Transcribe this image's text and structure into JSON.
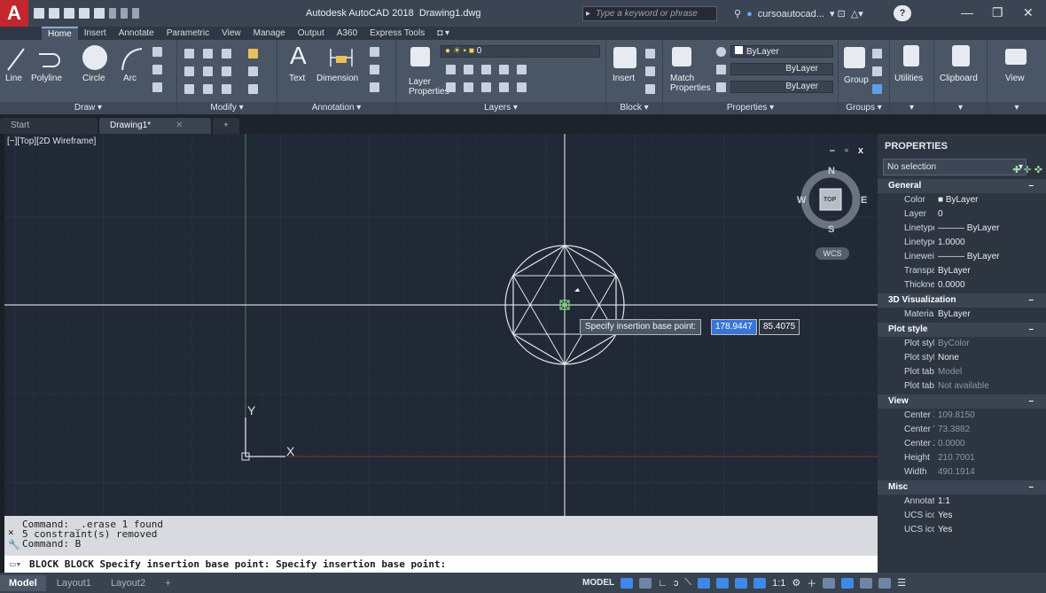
{
  "title": {
    "app": "Autodesk AutoCAD 2018",
    "document": "Drawing1.dwg"
  },
  "search": {
    "placeholder": "Type a keyword or phrase"
  },
  "user": {
    "name": "cursoautocad..."
  },
  "ribbon_tabs": [
    "Home",
    "Insert",
    "Annotate",
    "Parametric",
    "View",
    "Manage",
    "Output",
    "A360",
    "Express Tools"
  ],
  "panels": {
    "draw": {
      "title": "Draw ▾",
      "line": "Line",
      "polyline": "Polyline",
      "circle": "Circle",
      "arc": "Arc"
    },
    "modify": {
      "title": "Modify ▾"
    },
    "annotation": {
      "title": "Annotation ▾",
      "text": "Text",
      "dimension": "Dimension"
    },
    "layers": {
      "title": "Layers ▾",
      "properties_l1": "Layer",
      "properties_l2": "Properties",
      "layer_combo": "0"
    },
    "block": {
      "title": "Block ▾",
      "insert": "Insert"
    },
    "properties": {
      "title": "Properties ▾",
      "match_l1": "Match",
      "match_l2": "Properties",
      "color": "ByLayer",
      "linetype": "ByLayer",
      "lineweight": "ByLayer"
    },
    "groups": {
      "title": "Groups ▾",
      "group": "Group"
    },
    "utilities": {
      "label": "Utilities"
    },
    "clipboard": {
      "label": "Clipboard"
    },
    "view": {
      "label": "View"
    }
  },
  "doc_tabs": {
    "start": "Start",
    "drawing": "Drawing1*"
  },
  "viewport": {
    "label": "[−][Top][2D Wireframe]",
    "controls": "– ▫ x",
    "compass": {
      "n": "N",
      "s": "S",
      "e": "E",
      "w": "W",
      "cube": "TOP"
    },
    "wcs": "WCS",
    "ucs_x": "X",
    "ucs_y": "Y"
  },
  "tooltip": {
    "label": "Specify insertion base point:",
    "x_value": "178.9447",
    "y_value": "85.4075"
  },
  "command_history": [
    "Command: _.erase 1 found",
    "5 constraint(s) removed",
    "Command: B"
  ],
  "command_line": "BLOCK BLOCK Specify insertion base point: Specify insertion base point:",
  "properties_palette": {
    "title": "PROPERTIES",
    "selection": "No selection",
    "sections": [
      {
        "name": "General",
        "rows": [
          {
            "k": "Color",
            "v": "■ ByLayer"
          },
          {
            "k": "Layer",
            "v": "0"
          },
          {
            "k": "Linetype",
            "v": "——— ByLayer"
          },
          {
            "k": "Linetype s...",
            "v": "1.0000"
          },
          {
            "k": "Lineweight",
            "v": "——— ByLayer"
          },
          {
            "k": "Transparen...",
            "v": "ByLayer"
          },
          {
            "k": "Thickness",
            "v": "0.0000"
          }
        ]
      },
      {
        "name": "3D Visualization",
        "rows": [
          {
            "k": "Material",
            "v": "ByLayer"
          }
        ]
      },
      {
        "name": "Plot style",
        "rows": [
          {
            "k": "Plot style",
            "v": "ByColor",
            "dim": true
          },
          {
            "k": "Plot style t...",
            "v": "None"
          },
          {
            "k": "Plot table...",
            "v": "Model",
            "dim": true
          },
          {
            "k": "Plot table t...",
            "v": "Not available",
            "dim": true
          }
        ]
      },
      {
        "name": "View",
        "rows": [
          {
            "k": "Center X",
            "v": "109.8150",
            "dim": true
          },
          {
            "k": "Center Y",
            "v": "73.3882",
            "dim": true
          },
          {
            "k": "Center Z",
            "v": "0.0000",
            "dim": true
          },
          {
            "k": "Height",
            "v": "210.7001",
            "dim": true
          },
          {
            "k": "Width",
            "v": "490.1914",
            "dim": true
          }
        ]
      },
      {
        "name": "Misc",
        "rows": [
          {
            "k": "Annotatio...",
            "v": "1:1"
          },
          {
            "k": "UCS icon On",
            "v": "Yes"
          },
          {
            "k": "UCS icon a...",
            "v": "Yes"
          }
        ]
      }
    ]
  },
  "status": {
    "layout_tabs": [
      "Model",
      "Layout1",
      "Layout2"
    ],
    "model": "MODEL",
    "scale": "1:1"
  },
  "colors": {
    "accent": "#3875d7",
    "logo": "#c4262e",
    "canvas": "#212836"
  }
}
